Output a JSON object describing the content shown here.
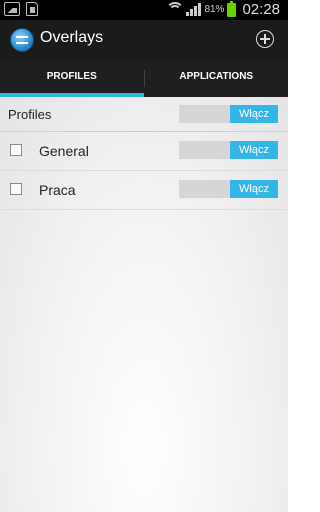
{
  "status_bar": {
    "battery_percent": "81%",
    "time": "02:28",
    "battery_color": "#5fd400"
  },
  "action_bar": {
    "title": "Overlays",
    "icon": "overlays-app-icon",
    "action_icon": "add-circle-icon"
  },
  "tabs": [
    {
      "label": "PROFILES",
      "active": true
    },
    {
      "label": "APPLICATIONS",
      "active": false
    }
  ],
  "accent_color": "#33b5e5",
  "profiles_header": {
    "label": "Profiles",
    "toggle_label": "Włącz"
  },
  "profiles": [
    {
      "name": "General",
      "checked": false,
      "toggle_label": "Włącz"
    },
    {
      "name": "Praca",
      "checked": false,
      "toggle_label": "Włącz"
    }
  ]
}
